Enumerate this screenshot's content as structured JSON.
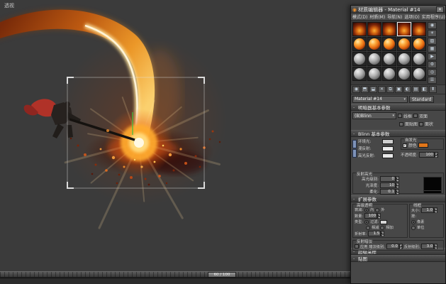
{
  "ui": {
    "collapse": "-",
    "dropdown_arrow": "▾",
    "check": "✓",
    "close": "✕"
  },
  "icons": {
    "material_editor": "◉",
    "sample_type": "◉",
    "backlight": "☀",
    "background": "▨",
    "sample_uv": "▦",
    "video_check": "▶",
    "options": "⚙",
    "select_by_mtl": "◎",
    "navigator": "☰",
    "get_material": "◉",
    "put_scene": "⬒",
    "assign": "⬓",
    "reset": "✕",
    "copy": "⧉",
    "put_library": "▣",
    "mtl_id": "◐",
    "show_viewport": "▤",
    "show_end": "◧",
    "go_parent": "⬆"
  },
  "viewport": {
    "label": "透视",
    "time_slider": "60 / 100"
  },
  "window": {
    "title": "材质编辑器 - Material #14"
  },
  "menu": {
    "items": [
      "模式(D)",
      "材质(M)",
      "导航(N)",
      "选项(O)",
      "实用程序(U)"
    ]
  },
  "name_row": {
    "material_name": "Material #14",
    "type_button": "Standard"
  },
  "rollouts": {
    "shader": {
      "title": "明暗器基本参数",
      "shader_type": "(B)Blinn",
      "wire": "线框",
      "two_sided": "双面",
      "face_map": "面贴图",
      "faceted": "面状"
    },
    "blinn": {
      "title": "Blinn 基本参数",
      "ambient": "环境光:",
      "diffuse": "漫反射:",
      "specular": "高光反射:",
      "swatch_colors": {
        "ambient": "#cfcfcf",
        "diffuse": "#eaeaea",
        "specular": "#e8e8e8",
        "self_illum": "#e0761a"
      },
      "self_illum": {
        "group": "自发光",
        "color": "颜色"
      },
      "opacity": {
        "label": "不透明度:",
        "value": "100"
      },
      "highlights": {
        "group": "反射高光",
        "specular_level": "高光级别:",
        "specular_level_value": "0",
        "glossiness": "光泽度:",
        "glossiness_value": "10",
        "soften": "柔化:",
        "soften_value": "0.1"
      }
    },
    "extended": {
      "title": "扩展参数",
      "adv_transparency": "高级透明",
      "falloff": "衰减:",
      "falloff_in": "内",
      "falloff_out": "外",
      "amount": "数量:",
      "amount_value": "100",
      "type": "类型:",
      "filter": "过滤:",
      "subtractive": "相减",
      "additive": "相加",
      "ior": "折射率:",
      "ior_value": "1.5",
      "wire_group": "线框",
      "size": "大小:",
      "size_value": "1.0",
      "in_label": "按:",
      "pixels": "像素",
      "units": "单位",
      "refl_dim": "反射暗淡",
      "apply": "应用",
      "dim_level": "暗淡级别:",
      "dim_level_value": "0.0",
      "refl_level": "反射级别:",
      "refl_level_value": "3.0"
    },
    "supersampling": {
      "title": "超级采样"
    },
    "maps": {
      "title": "贴图"
    }
  },
  "scene_colors": {
    "flame_bright": "#ffd470",
    "flame_mid": "#f09a28",
    "flame_dark": "#7a2a08",
    "burst_core": "#fff9e4",
    "cape_red": "#b03228",
    "gizmo_green": "#39c13f"
  }
}
